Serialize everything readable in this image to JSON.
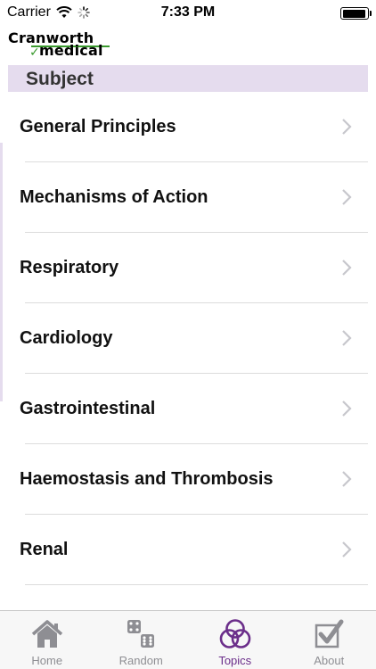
{
  "status_bar": {
    "carrier": "Carrier",
    "time": "7:33 PM",
    "battery_level": 0.95
  },
  "logo": {
    "line1": "Cranworth",
    "line2": "medical"
  },
  "section": {
    "title": "Subject"
  },
  "topics": [
    {
      "label": "General Principles"
    },
    {
      "label": "Mechanisms of Action"
    },
    {
      "label": "Respiratory"
    },
    {
      "label": "Cardiology"
    },
    {
      "label": "Gastrointestinal"
    },
    {
      "label": "Haemostasis and Thrombosis"
    },
    {
      "label": "Renal"
    }
  ],
  "tabs": [
    {
      "label": "Home",
      "icon": "home-icon"
    },
    {
      "label": "Random",
      "icon": "dice-icon"
    },
    {
      "label": "Topics",
      "icon": "rings-icon",
      "active": true
    },
    {
      "label": "About",
      "icon": "checkbox-icon"
    }
  ],
  "colors": {
    "accent": "#6b2e8a",
    "header_bg": "#e5dcee",
    "logo_green": "#3a9a2e",
    "tab_inactive": "#8e8e93"
  }
}
